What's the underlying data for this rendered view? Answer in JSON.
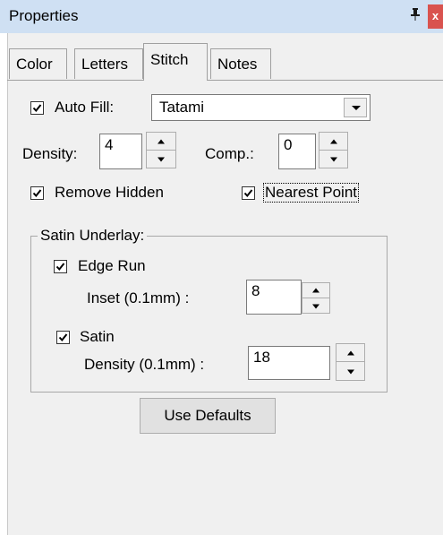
{
  "window": {
    "title": "Properties",
    "pin_icon": "pin-icon",
    "close_icon": "close-icon",
    "close_glyph": "x"
  },
  "tabs": [
    {
      "label": "Color",
      "active": false
    },
    {
      "label": "Letters",
      "active": false
    },
    {
      "label": "Stitch",
      "active": true
    },
    {
      "label": "Notes",
      "active": false
    }
  ],
  "stitch": {
    "auto_fill": {
      "label": "Auto Fill:",
      "checked": true,
      "value": "Tatami"
    },
    "density": {
      "label": "Density:",
      "value": "4"
    },
    "comp": {
      "label": "Comp.:",
      "value": "0"
    },
    "remove_hidden": {
      "label": "Remove Hidden",
      "checked": true
    },
    "nearest_point": {
      "label": "Nearest Point",
      "checked": true
    },
    "satin_underlay": {
      "legend": "Satin Underlay:",
      "edge_run": {
        "label": "Edge Run",
        "checked": true
      },
      "inset": {
        "label": "Inset (0.1mm) :",
        "value": "8"
      },
      "satin": {
        "label": "Satin",
        "checked": true
      },
      "satin_density": {
        "label": "Density (0.1mm) :",
        "value": "18"
      }
    },
    "use_defaults_label": "Use Defaults"
  },
  "colors": {
    "titlebar": "#cfe0f3",
    "close": "#d9534f",
    "panel": "#f0f0f0"
  }
}
